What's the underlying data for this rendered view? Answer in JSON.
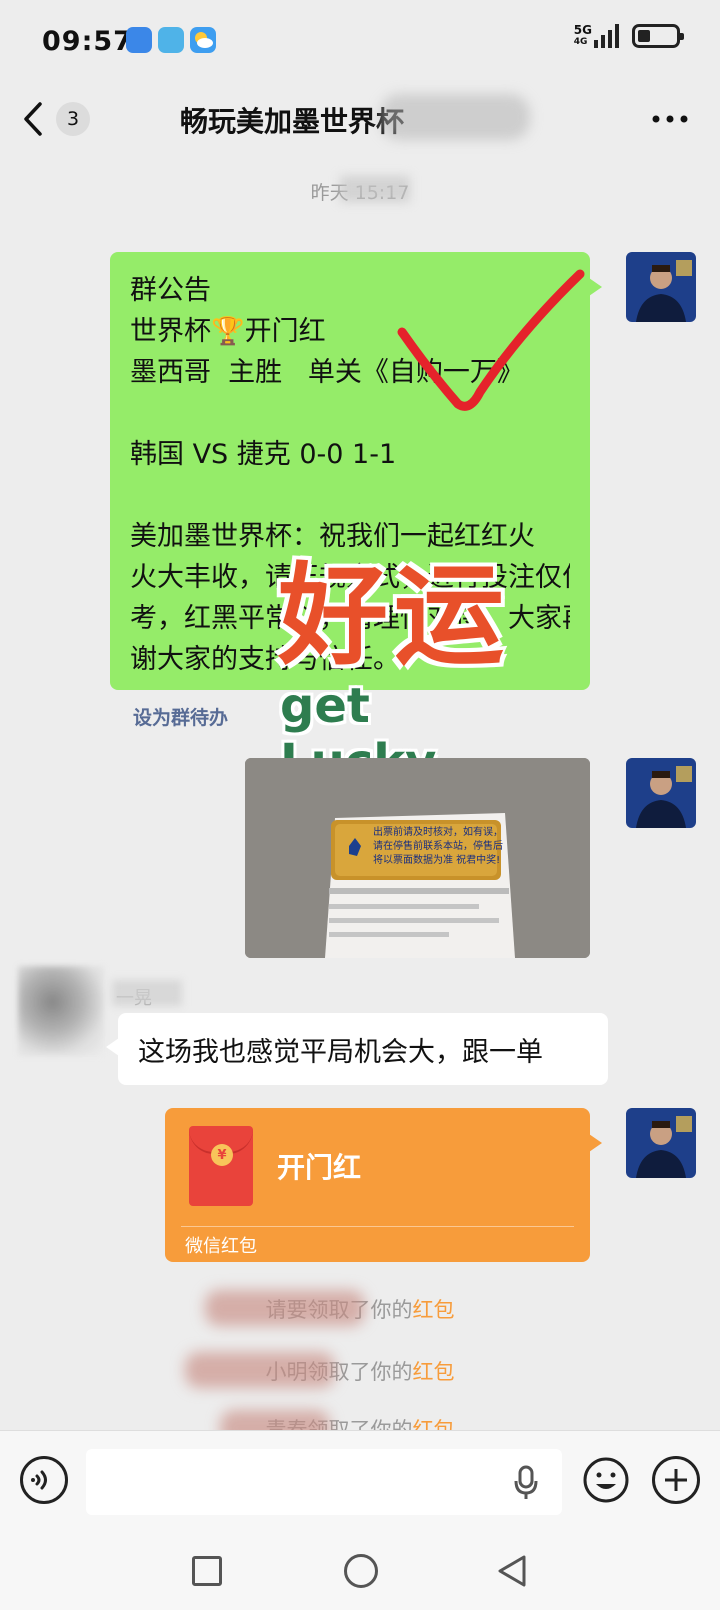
{
  "status_bar": {
    "time": "09:57",
    "network": "5G",
    "network_sub": "4G"
  },
  "header": {
    "unread_count": "3",
    "title": "畅玩美加墨世界杯"
  },
  "messages": {
    "timestamp": "昨天 15:17",
    "notice": {
      "line1": "群公告",
      "line2": "世界杯🏆开门红",
      "line3": "墨西哥  主胜   单关《自购一万》",
      "line4": "韩国 VS 捷克 0-0 1-1",
      "line5": "美加墨世界杯：祝我们一起红红火",
      "line6": "火大丰收，请正规方式，进行投注仅作参",
      "line7": "考，红黑平常心，请理性对待，大家再次感",
      "line8": "谢大家的支持与信任。"
    },
    "set_todo": "设为群待办",
    "sticker": {
      "big": "好运",
      "small": "get Lucky"
    },
    "photo_ticket": {
      "line1": "出票前请及时核对，如有误，",
      "line2": "请在停售前联系本站，停售后",
      "line3": "将以票面数据为准    祝君中奖!"
    },
    "other": {
      "name": "一晃",
      "text": "这场我也感觉平局机会大，跟一单"
    },
    "red_packet": {
      "title": "开门红",
      "label": "微信红包",
      "coin": "¥"
    },
    "system": [
      {
        "prefix": "请要领取了你的",
        "highlight": "红包"
      },
      {
        "prefix": "小明领取了你的",
        "highlight": "红包"
      },
      {
        "prefix": "青春领取了你的",
        "highlight": "红包"
      }
    ]
  },
  "colors": {
    "bubble_self": "#95ec69",
    "red_packet": "#f79c3b",
    "link": "#576b95",
    "background": "#ededed"
  },
  "icons": {
    "back": "chevron-left-icon",
    "more": "more-horizontal-icon",
    "voice": "voice-icon",
    "mic": "mic-icon",
    "emoji": "emoji-icon",
    "plus": "plus-icon"
  }
}
